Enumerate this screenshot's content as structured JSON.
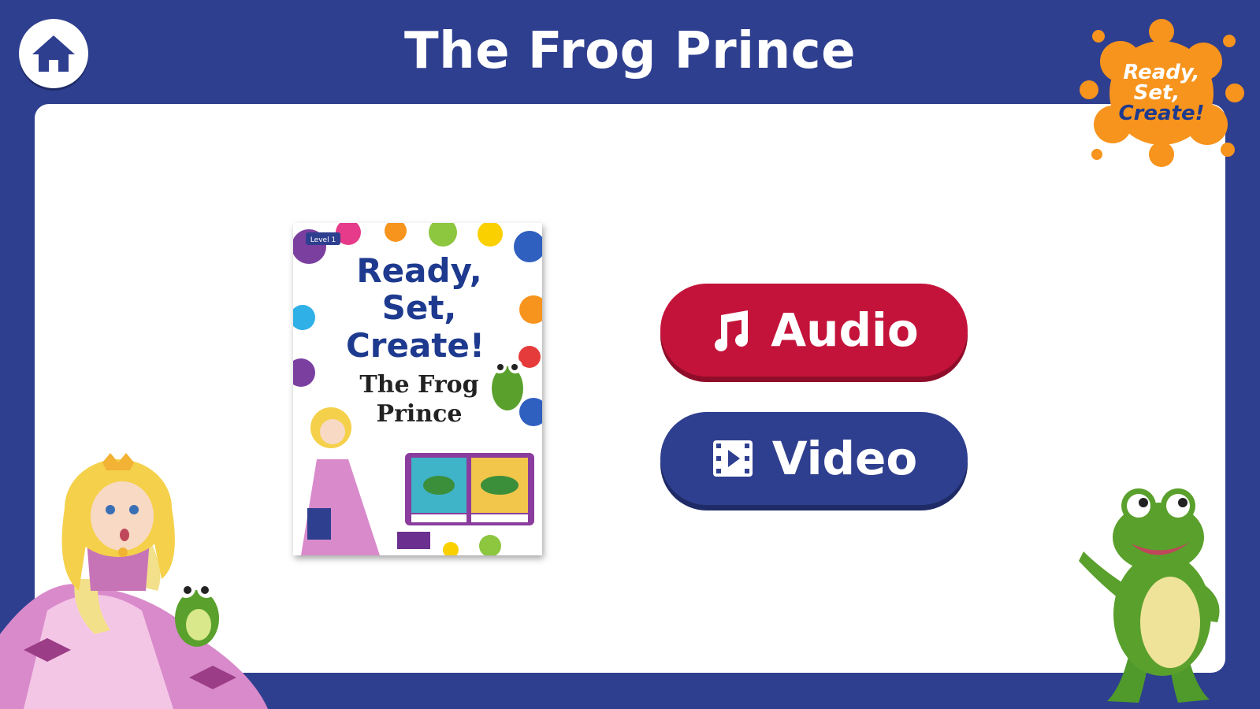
{
  "header": {
    "title": "The Frog Prince"
  },
  "logo": {
    "line1": "Ready,",
    "line2": "Set,",
    "line3": "Create!"
  },
  "book_cover": {
    "level": "Level 1",
    "series_line1": "Ready,",
    "series_line2": "Set,",
    "series_line3": "Create!",
    "title_line1": "The Frog",
    "title_line2": "Prince"
  },
  "buttons": {
    "audio_label": "Audio",
    "video_label": "Video"
  },
  "colors": {
    "background": "#2f3f8f",
    "audio": "#c4133a",
    "video": "#2f3f8f",
    "logo_splash": "#f7941d"
  },
  "icons": {
    "home": "home-icon",
    "audio": "music-note-icon",
    "video": "film-play-icon"
  }
}
